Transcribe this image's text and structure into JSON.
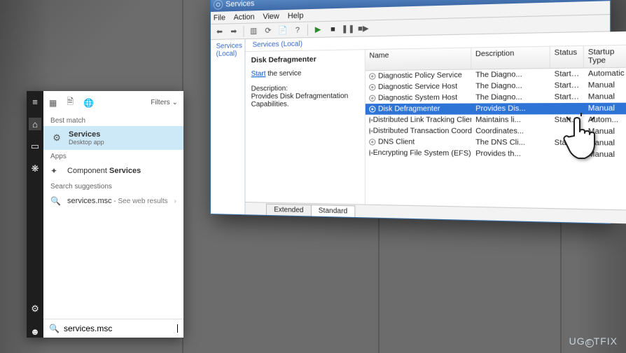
{
  "search": {
    "filters_label": "Filters",
    "best_match_label": "Best match",
    "best": {
      "title": "Services",
      "subtitle": "Desktop app"
    },
    "apps_label": "Apps",
    "app_item": {
      "prefix": "Component ",
      "bold": "Services"
    },
    "suggestions_label": "Search suggestions",
    "sugg_item": {
      "text": "services.msc",
      "suffix": " - See web results"
    },
    "input_value": "services.msc"
  },
  "services": {
    "title": "Services",
    "menu": [
      "File",
      "Action",
      "View",
      "Help"
    ],
    "left_pane_label": "Services (Local)",
    "right_head_label": "Services (Local)",
    "detail": {
      "name": "Disk Defragmenter",
      "start_word": "Start",
      "start_suffix": " the service",
      "desc_label": "Description:",
      "desc_text": "Provides Disk Defragmentation Capabilities."
    },
    "columns": {
      "name": "Name",
      "desc": "Description",
      "status": "Status",
      "type": "Startup Type"
    },
    "rows": [
      {
        "name": "Diagnostic Policy Service",
        "desc": "The Diagno...",
        "status": "Started",
        "type": "Automatic",
        "sel": false
      },
      {
        "name": "Diagnostic Service Host",
        "desc": "The Diagno...",
        "status": "Started",
        "type": "Manual",
        "sel": false
      },
      {
        "name": "Diagnostic System Host",
        "desc": "The Diagno...",
        "status": "Started",
        "type": "Manual",
        "sel": false
      },
      {
        "name": "Disk Defragmenter",
        "desc": "Provides Dis...",
        "status": "",
        "type": "Manual",
        "sel": true
      },
      {
        "name": "Distributed Link Tracking Client",
        "desc": "Maintains li...",
        "status": "Started",
        "type": "Autom...",
        "sel": false
      },
      {
        "name": "Distributed Transaction Coordin...",
        "desc": "Coordinates...",
        "status": "",
        "type": "Manual",
        "sel": false
      },
      {
        "name": "DNS Client",
        "desc": "The DNS Cli...",
        "status": "Started",
        "type": "Manual",
        "sel": false
      },
      {
        "name": "Encrypting File System (EFS)",
        "desc": "Provides th...",
        "status": "",
        "type": "Manual",
        "sel": false
      }
    ],
    "tabs": {
      "extended": "Extended",
      "standard": "Standard"
    }
  },
  "watermark": {
    "pre": "UG",
    "ring": "E",
    "post": "TFIX"
  }
}
